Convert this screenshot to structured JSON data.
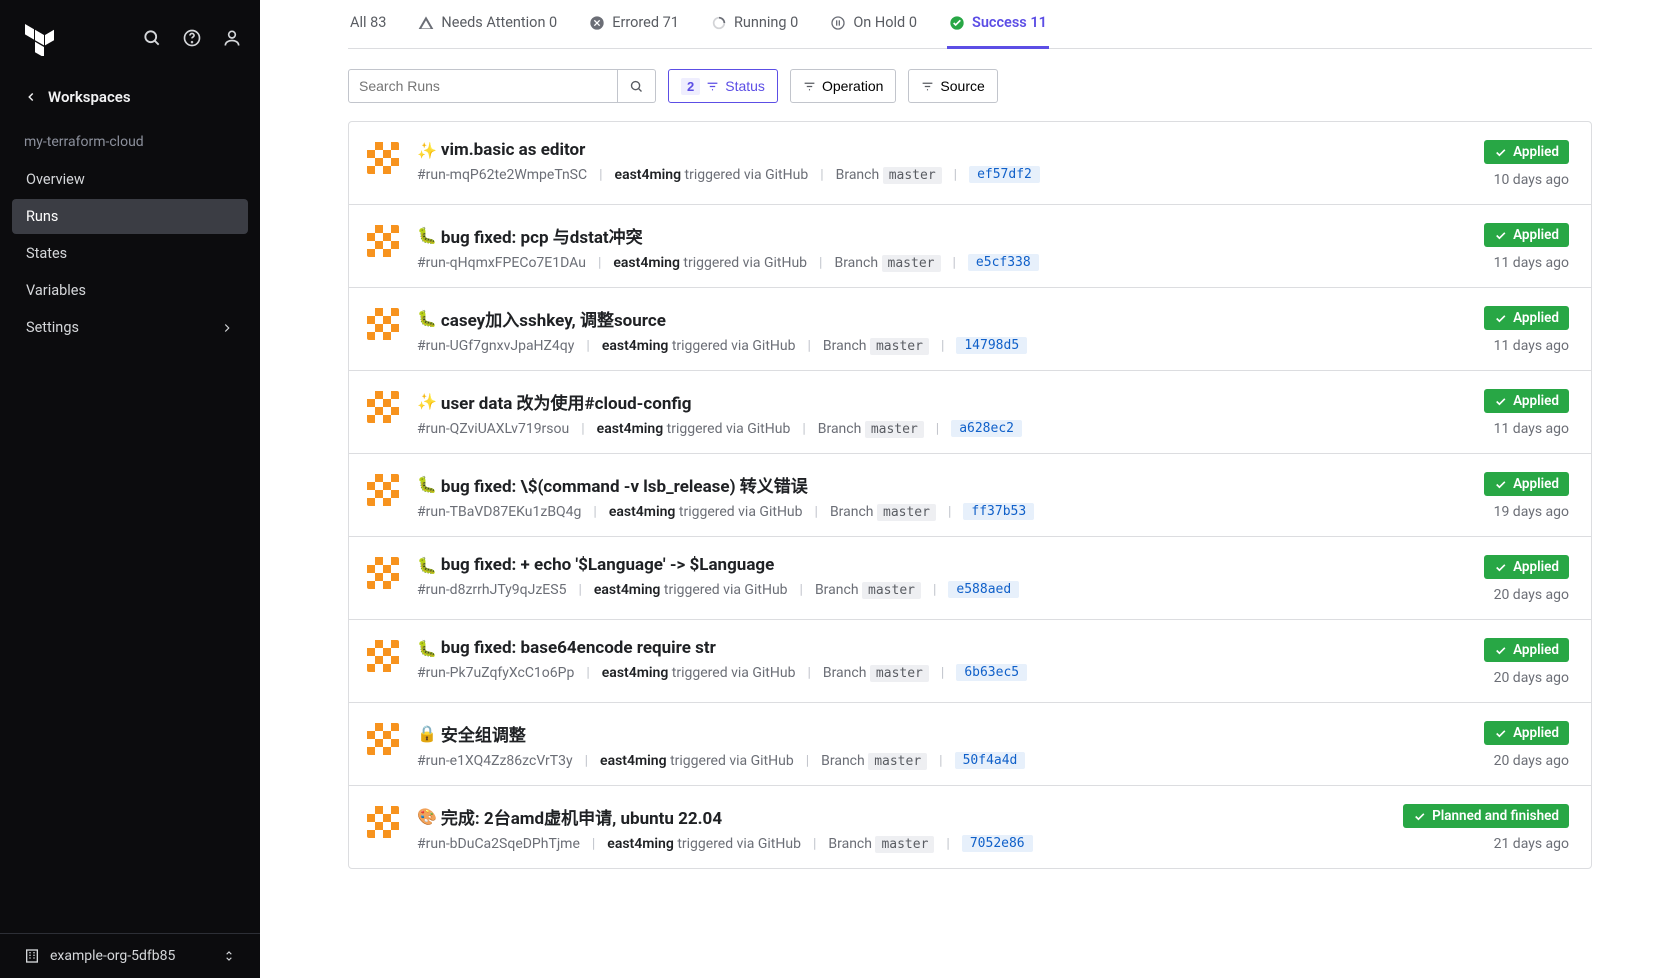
{
  "sidebar": {
    "back_label": "Workspaces",
    "org_name": "my-terraform-cloud",
    "items": [
      {
        "label": "Overview",
        "active": false,
        "has_chevron": false
      },
      {
        "label": "Runs",
        "active": true,
        "has_chevron": false
      },
      {
        "label": "States",
        "active": false,
        "has_chevron": false
      },
      {
        "label": "Variables",
        "active": false,
        "has_chevron": false
      },
      {
        "label": "Settings",
        "active": false,
        "has_chevron": true
      }
    ],
    "footer": "example-org-5dfb85"
  },
  "tabs": [
    {
      "icon": "none",
      "label": "All 83",
      "active": false
    },
    {
      "icon": "warning",
      "label": "Needs Attention 0",
      "active": false
    },
    {
      "icon": "error",
      "label": "Errored 71",
      "active": false
    },
    {
      "icon": "spinner",
      "label": "Running 0",
      "active": false
    },
    {
      "icon": "pause",
      "label": "On Hold 0",
      "active": false
    },
    {
      "icon": "success",
      "label": "Success 11",
      "active": true
    }
  ],
  "search_placeholder": "Search Runs",
  "filters": {
    "status": {
      "label": "Status",
      "count": "2",
      "active": true
    },
    "operation": {
      "label": "Operation",
      "active": false
    },
    "source": {
      "label": "Source",
      "active": false
    }
  },
  "branch_prefix": "Branch",
  "trigger_text": "triggered via GitHub",
  "runs": [
    {
      "emoji": "✨",
      "title": "vim.basic as editor",
      "id": "#run-mqP62te2WmpeTnSC",
      "user": "east4ming",
      "branch": "master",
      "commit": "ef57df2",
      "status": "Applied",
      "time": "10 days ago"
    },
    {
      "emoji": "🐛",
      "title": "bug fixed: pcp 与dstat冲突",
      "id": "#run-qHqmxFPECo7E1DAu",
      "user": "east4ming",
      "branch": "master",
      "commit": "e5cf338",
      "status": "Applied",
      "time": "11 days ago"
    },
    {
      "emoji": "🐛",
      "title": "casey加入sshkey, 调整source",
      "id": "#run-UGf7gnxvJpaHZ4qy",
      "user": "east4ming",
      "branch": "master",
      "commit": "14798d5",
      "status": "Applied",
      "time": "11 days ago"
    },
    {
      "emoji": "✨",
      "title": "user data 改为使用#cloud-config",
      "id": "#run-QZviUAXLv719rsou",
      "user": "east4ming",
      "branch": "master",
      "commit": "a628ec2",
      "status": "Applied",
      "time": "11 days ago"
    },
    {
      "emoji": "🐛",
      "title": "bug fixed: \\$(command -v lsb_release) 转义错误",
      "id": "#run-TBaVD87EKu1zBQ4g",
      "user": "east4ming",
      "branch": "master",
      "commit": "ff37b53",
      "status": "Applied",
      "time": "19 days ago"
    },
    {
      "emoji": "🐛",
      "title": "bug fixed: + echo '$Language' -> $Language",
      "id": "#run-d8zrrhJTy9qJzES5",
      "user": "east4ming",
      "branch": "master",
      "commit": "e588aed",
      "status": "Applied",
      "time": "20 days ago"
    },
    {
      "emoji": "🐛",
      "title": "bug fixed: base64encode require str",
      "id": "#run-Pk7uZqfyXcC1o6Pp",
      "user": "east4ming",
      "branch": "master",
      "commit": "6b63ec5",
      "status": "Applied",
      "time": "20 days ago"
    },
    {
      "emoji": "🔒",
      "title": "安全组调整",
      "id": "#run-e1XQ4Zz86zcVrT3y",
      "user": "east4ming",
      "branch": "master",
      "commit": "50f4a4d",
      "status": "Applied",
      "time": "20 days ago"
    },
    {
      "emoji": "🎨",
      "title": "完成: 2台amd虚机申请, ubuntu 22.04",
      "id": "#run-bDuCa2SqeDPhTjme",
      "user": "east4ming",
      "branch": "master",
      "commit": "7052e86",
      "status": "Planned and finished",
      "time": "21 days ago"
    }
  ]
}
